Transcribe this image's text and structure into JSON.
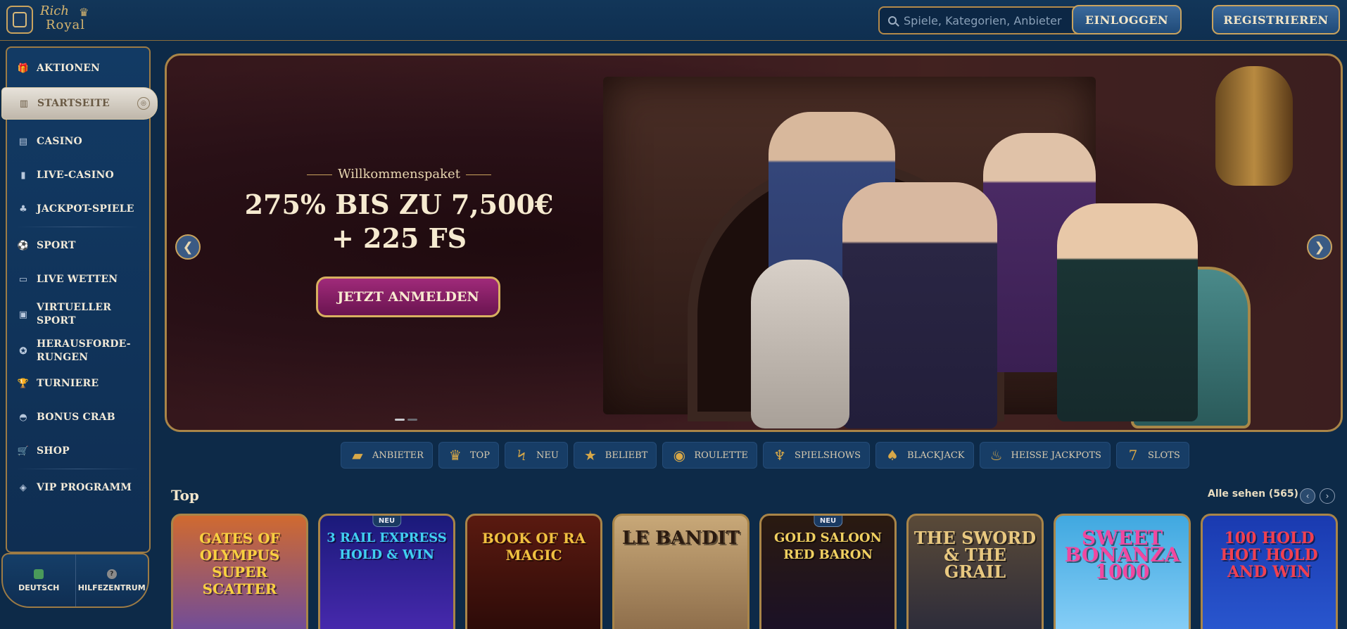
{
  "header": {
    "logo_line1": "Rich",
    "logo_line2": "Royal",
    "search_placeholder": "Spiele, Kategorien, Anbieter",
    "login_label": "EINLOGGEN",
    "register_label": "REGISTRIEREN"
  },
  "sidebar": {
    "items": [
      {
        "label": "AKTIONEN",
        "icon": "gift-icon"
      },
      {
        "label": "STARTSEITE",
        "icon": "home-icon",
        "active": true
      },
      {
        "label": "CASINO",
        "icon": "slot-machine-icon"
      },
      {
        "label": "LIVE-CASINO",
        "icon": "cards-icon"
      },
      {
        "label": "JACKPOT-SPIELE",
        "icon": "clover-icon"
      },
      {
        "label": "SPORT",
        "icon": "ball-icon"
      },
      {
        "label": "LIVE WETTEN",
        "icon": "live-icon"
      },
      {
        "label": "VIRTUELLER SPORT",
        "icon": "monitor-icon"
      },
      {
        "label": "HERAUSFORDE-RUNGEN",
        "icon": "medal-icon"
      },
      {
        "label": "TURNIERE",
        "icon": "trophy-icon"
      },
      {
        "label": "BONUS CRAB",
        "icon": "crab-icon"
      },
      {
        "label": "SHOP",
        "icon": "basket-icon"
      },
      {
        "label": "VIP PROGRAMM",
        "icon": "diamond-icon"
      }
    ],
    "language_label": "DEUTSCH",
    "help_label": "HILFEZENTRUM"
  },
  "banner": {
    "subtitle": "Willkommenspaket",
    "title_line1": "275% BIS ZU 7,500€",
    "title_line2": "+ 225 FS",
    "cta_label": "JETZT ANMELDEN",
    "slides": 2,
    "active_slide": 1
  },
  "categories": [
    {
      "label": "ANBIETER",
      "icon": "book-icon"
    },
    {
      "label": "TOP",
      "icon": "crown-icon"
    },
    {
      "label": "NEU",
      "icon": "lightning-icon"
    },
    {
      "label": "BELIEBT",
      "icon": "star-icon"
    },
    {
      "label": "ROULETTE",
      "icon": "roulette-icon"
    },
    {
      "label": "SPIELSHOWS",
      "icon": "microphone-icon"
    },
    {
      "label": "BLACKJACK",
      "icon": "cards-icon"
    },
    {
      "label": "HEISSE JACKPOTS",
      "icon": "lamp-icon"
    },
    {
      "label": "SLOTS",
      "icon": "seven-icon"
    }
  ],
  "top_section": {
    "title": "Top",
    "see_all": "Alle sehen (565)",
    "games": [
      {
        "title": "GATES OF OLYMPUS SUPER SCATTER",
        "badge": ""
      },
      {
        "title": "3 RAIL EXPRESS HOLD & WIN",
        "badge": "NEU"
      },
      {
        "title": "BOOK OF RA MAGIC",
        "badge": ""
      },
      {
        "title": "LE BANDIT",
        "badge": ""
      },
      {
        "title": "GOLD SALOON RED BARON",
        "badge": "NEU"
      },
      {
        "title": "THE SWORD & THE GRAIL",
        "badge": ""
      },
      {
        "title": "SWEET BONANZA 1000",
        "badge": ""
      },
      {
        "title": "100 HOLD HOT HOLD AND WIN",
        "badge": ""
      }
    ]
  }
}
